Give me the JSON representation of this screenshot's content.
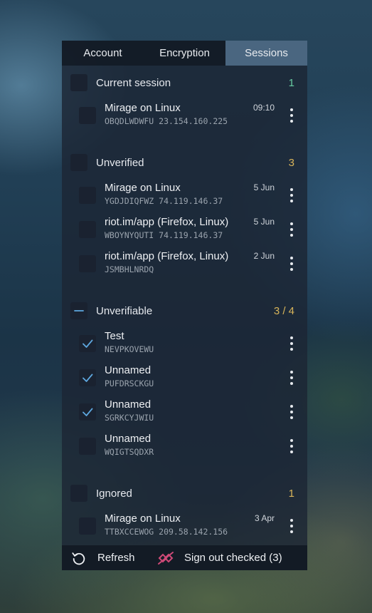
{
  "tabs": [
    {
      "label": "Account",
      "active": false
    },
    {
      "label": "Encryption",
      "active": false
    },
    {
      "label": "Sessions",
      "active": true
    }
  ],
  "colors": {
    "count_current": "#66c9a0",
    "count_other": "#d8b45a",
    "check_accent": "#5ea8e0",
    "signout_icon": "#d04a78"
  },
  "groups": [
    {
      "title": "Current session",
      "count": "1",
      "count_color": "#66c9a0",
      "state": "unchecked",
      "sessions": [
        {
          "name": "Mirage on Linux",
          "device": "OBQDLWDWFU 23.154.160.225",
          "date": "09:10",
          "checked": false
        }
      ]
    },
    {
      "title": "Unverified",
      "count": "3",
      "count_color": "#d8b45a",
      "state": "unchecked",
      "sessions": [
        {
          "name": "Mirage on Linux",
          "device": "YGDJDIQFWZ 74.119.146.37",
          "date": "5 Jun",
          "checked": false
        },
        {
          "name": "riot.im/app (Firefox, Linux)",
          "device": "WBOYNYQUTI 74.119.146.37",
          "date": "5 Jun",
          "checked": false
        },
        {
          "name": "riot.im/app (Firefox, Linux)",
          "device": "JSMBHLNRDQ",
          "date": "2 Jun",
          "checked": false
        }
      ]
    },
    {
      "title": "Unverifiable",
      "count": "3 / 4",
      "count_color": "#d8b45a",
      "state": "partial",
      "sessions": [
        {
          "name": "Test",
          "device": "NEVPKOVEWU",
          "date": "",
          "checked": true
        },
        {
          "name": "Unnamed",
          "device": "PUFDRSCKGU",
          "date": "",
          "checked": true
        },
        {
          "name": "Unnamed",
          "device": "SGRKCYJWIU",
          "date": "",
          "checked": true
        },
        {
          "name": "Unnamed",
          "device": "WQIGTSQDXR",
          "date": "",
          "checked": false
        }
      ]
    },
    {
      "title": "Ignored",
      "count": "1",
      "count_color": "#d8b45a",
      "state": "unchecked",
      "sessions": [
        {
          "name": "Mirage on Linux",
          "device": "TTBXCCEWOG 209.58.142.156",
          "date": "3 Apr",
          "checked": false
        }
      ]
    }
  ],
  "footer": {
    "refresh_label": "Refresh",
    "refresh_icon": "refresh-icon",
    "signout_label": "Sign out checked (3)",
    "signout_icon": "sign-out-icon"
  }
}
